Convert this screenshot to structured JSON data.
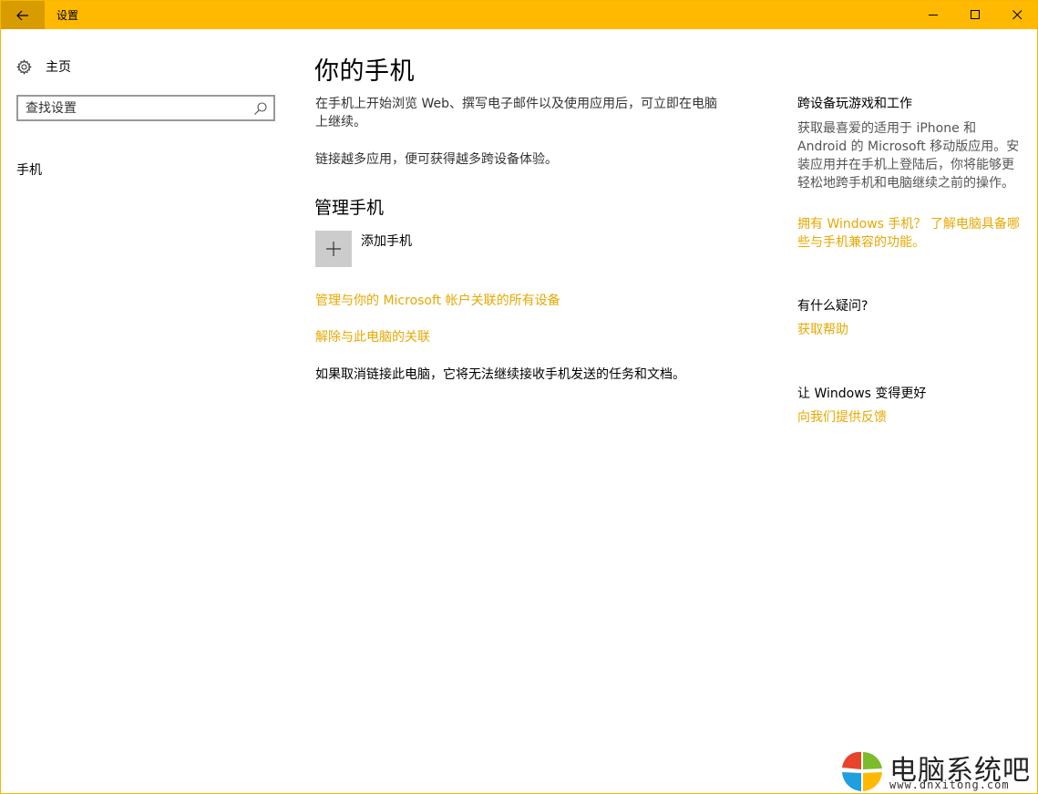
{
  "titlebar": {
    "title": "设置",
    "accent_color": "#ffb900",
    "back_icon": "back-arrow-icon",
    "minimize_icon": "minimize-icon",
    "maximize_icon": "maximize-icon",
    "close_icon": "close-icon"
  },
  "sidebar": {
    "home_label": "主页",
    "home_icon": "gear-icon",
    "search_placeholder": "查找设置",
    "search_icon": "search-icon",
    "items": [
      {
        "label": "手机"
      }
    ]
  },
  "main": {
    "title": "你的手机",
    "description": "在手机上开始浏览 Web、撰写电子邮件以及使用应用后，可立即在电脑上继续。",
    "description2": "链接越多应用，便可获得越多跨设备体验。",
    "manage_title": "管理手机",
    "add_phone_label": "添加手机",
    "add_icon": "plus-icon",
    "link_manage_devices": "管理与你的 Microsoft 帐户关联的所有设备",
    "link_unlink": "解除与此电脑的关联",
    "unlink_note": "如果取消链接此电脑，它将无法继续接收手机发送的任务和文档。",
    "link_color": "#e8a800"
  },
  "side": {
    "cross_device_heading": "跨设备玩游戏和工作",
    "cross_device_text": "获取最喜爱的适用于 iPhone 和 Android 的 Microsoft 移动版应用。安装应用并在手机上登陆后，你将能够更轻松地跨手机和电脑继续之前的操作。",
    "windows_phone_link": "拥有 Windows 手机？ 了解电脑具备哪些与手机兼容的功能。",
    "questions_heading": "有什么疑问?",
    "get_help_link": "获取帮助",
    "better_heading": "让 Windows 变得更好",
    "feedback_link": "向我们提供反馈"
  },
  "watermark": {
    "name": "电脑系统吧",
    "url": "www.dnxitong.com",
    "logo_icon": "windows-logo-icon"
  }
}
